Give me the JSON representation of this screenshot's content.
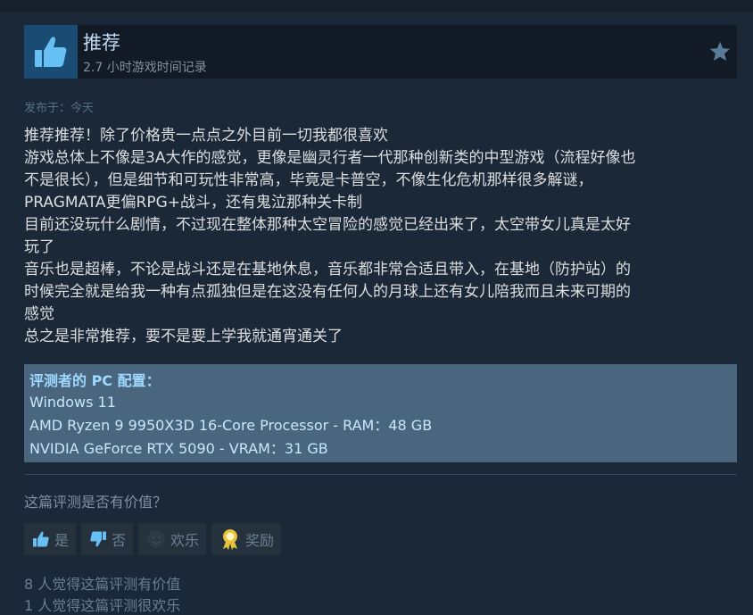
{
  "review": {
    "title": "推荐",
    "hours": "2.7 小时游戏时间记录",
    "posted": "发布于：今天",
    "lines": [
      "推荐推荐！除了价格贵一点点之外目前一切我都很喜欢",
      "游戏总体上不像是3A大作的感觉，更像是幽灵行者一代那种创新类的中型游戏（流程好像也",
      "不是很长），但是细节和可玩性非常高，毕竟是卡普空，不像生化危机那样很多解谜，",
      "PRAGMATA更偏RPG+战斗，还有鬼泣那种关卡制",
      "目前还没玩什么剧情，不过现在整体那种太空冒险的感觉已经出来了，太空带女儿真是太好",
      "玩了",
      "音乐也是超棒，不论是战斗还是在基地休息，音乐都非常合适且带入，在基地（防护站）的",
      "时候完全就是给我一种有点孤独但是在这没有任何人的月球上还有女儿陪我而且未来可期的",
      "感觉",
      "总之是非常推荐，要不是要上学我就通宵通关了"
    ]
  },
  "specs": {
    "title": "评测者的 PC 配置：",
    "os": "Windows 11",
    "cpu": "AMD Ryzen 9 9950X3D 16-Core Processor - RAM：48 GB",
    "gpu": "NVIDIA GeForce RTX 5090 - VRAM：31 GB"
  },
  "feedback": {
    "question": "这篇评测是否有价值？",
    "yes": "是",
    "no": "否",
    "funny": "欢乐",
    "award": "奖励",
    "helpful_count": "8 人觉得这篇评测有价值",
    "funny_count": "1 人觉得这篇评测很欢乐"
  },
  "icons": {
    "recommend": "thumbs-up-icon",
    "favorite": "star-icon",
    "vote_yes": "thumbs-up-icon",
    "vote_no": "thumbs-down-icon",
    "vote_funny": "smiley-icon",
    "award": "award-medal-icon"
  },
  "colors": {
    "background": "#1b2838",
    "thumb_box": "#1a4b73",
    "title": "#c1dbf4",
    "spec_box": "#4a657e",
    "award_gold": "#e8c23a"
  }
}
